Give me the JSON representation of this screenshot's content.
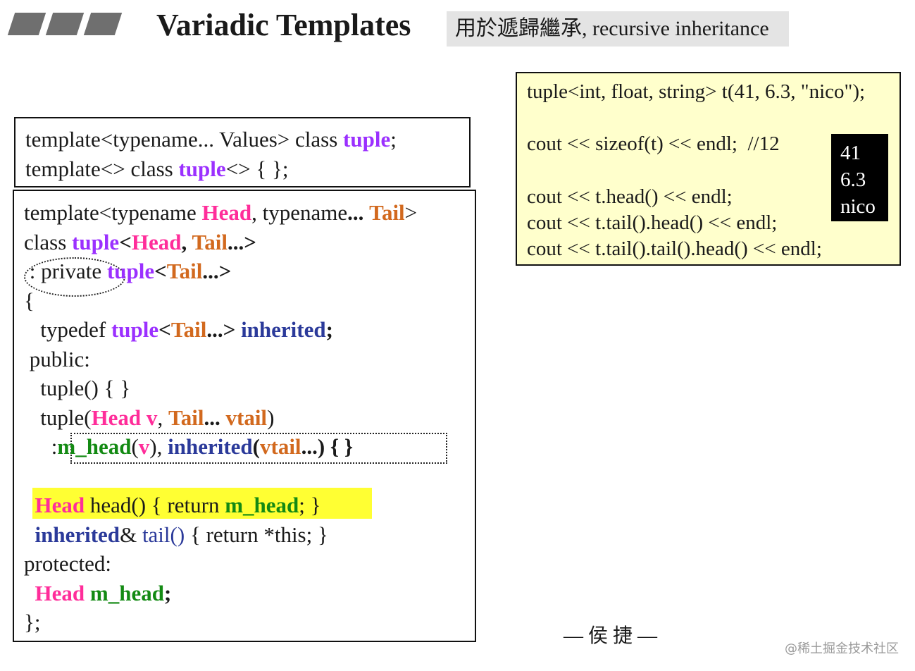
{
  "header": {
    "title": "Variadic Templates",
    "subtitle": "用於遞歸繼承, recursive inheritance"
  },
  "declarations": {
    "line1": [
      "template<typename... Values> class ",
      "tuple",
      ";"
    ],
    "line2": [
      "template<> class ",
      "tuple",
      "<> { };"
    ]
  },
  "class_code": {
    "l1": [
      "template<typename ",
      "Head",
      ", typename",
      "...",
      " ",
      "Tail",
      ">"
    ],
    "l2": [
      "class ",
      "tuple",
      "<",
      "Head",
      ", ",
      "Tail",
      "...>"
    ],
    "l3": [
      " : private ",
      "tuple",
      "<",
      "Tail",
      "...>"
    ],
    "l4": "{",
    "l5": [
      "   typedef ",
      "tuple",
      "<",
      "Tail",
      "...> ",
      "inherited",
      ";"
    ],
    "l6": " public:",
    "l7": "   tuple() { }",
    "l8": [
      "   tuple(",
      "Head v",
      ", ",
      "Tail",
      "...",
      " ",
      "vtail",
      ")"
    ],
    "l9": [
      "     :",
      "m_head",
      "(",
      "v",
      "), ",
      "inherited",
      "(",
      "vtail",
      "...) { }"
    ],
    "l10": [
      "  ",
      "Head",
      " head() { return ",
      "m_head",
      "; }"
    ],
    "l11": [
      "  ",
      "inherited",
      "& ",
      "tail()",
      " { return *this; }"
    ],
    "l12": "protected:",
    "l13": [
      "  ",
      "Head",
      " ",
      "m_head",
      ";"
    ],
    "l14": "};"
  },
  "usage_code": {
    "l1": "tuple<int, float, string> t(41, 6.3, \"nico\");",
    "l2": "cout << sizeof(t) << endl;  //12",
    "l3": "cout << t.head() << endl;",
    "l4": "cout << t.tail().head() << endl;",
    "l5": "cout << t.tail().tail().head() << endl;"
  },
  "output": [
    "41",
    "6.3",
    "nico"
  ],
  "author": "— 侯 捷 —",
  "watermark": "@稀土掘金技术社区",
  "colors": {
    "tuple": "#9b30ff",
    "head": "#ff2d9a",
    "tail": "#d2691e",
    "member": "#138a13",
    "inherited": "#2b3a9a",
    "highlight": "#ffff33",
    "usage_bg": "#ffffcc",
    "subtitle_bg": "#e4e4e4"
  }
}
